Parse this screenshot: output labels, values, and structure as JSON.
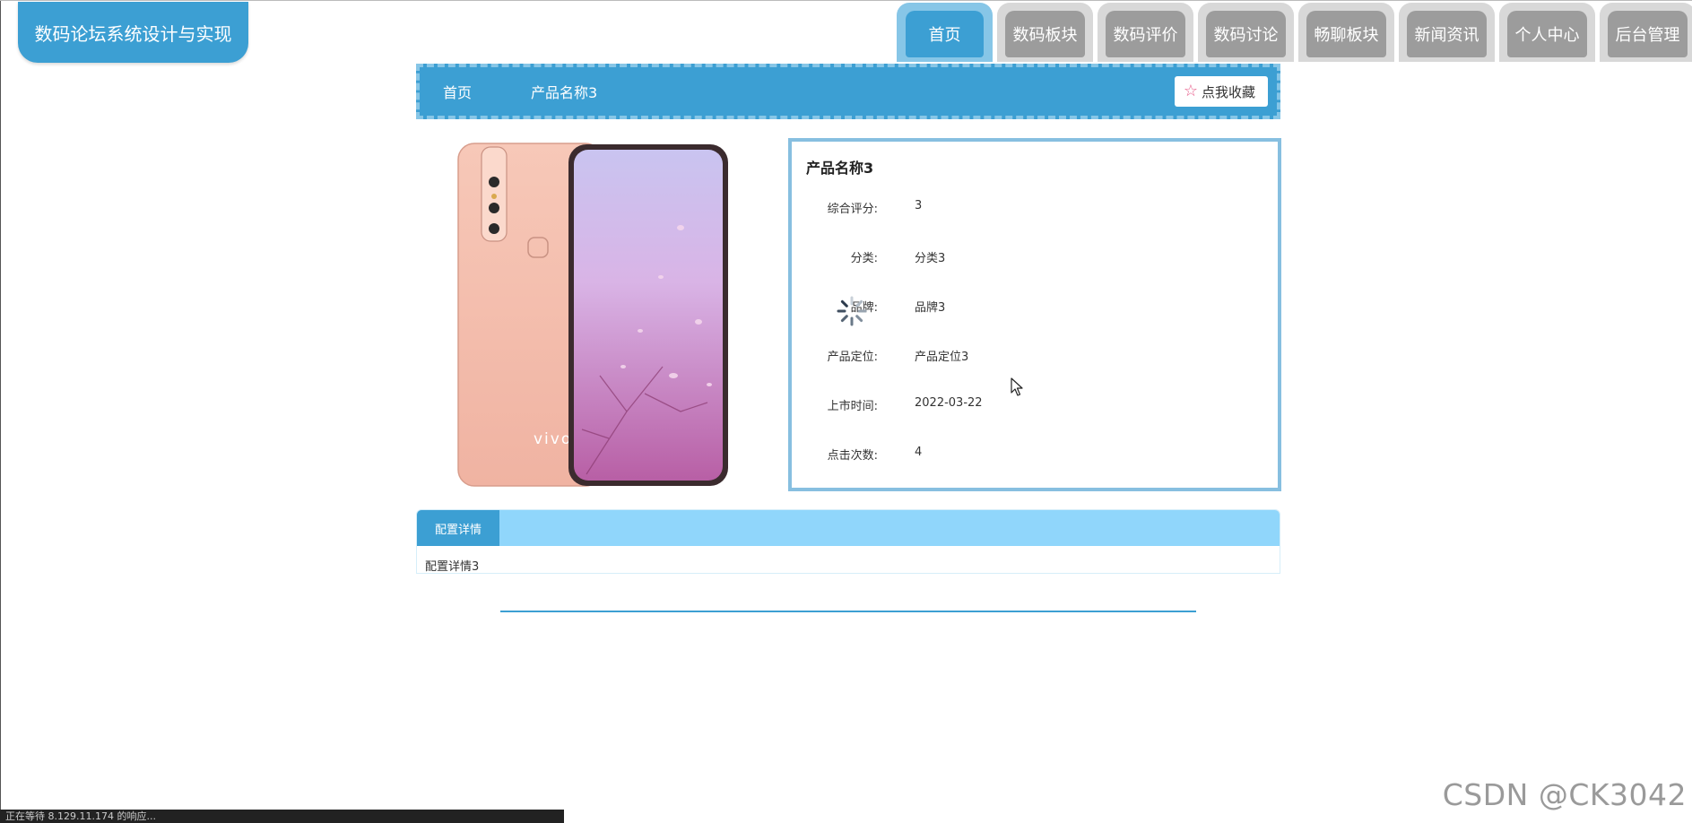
{
  "site": {
    "logo_text": "数码论坛系统设计与实现"
  },
  "nav": {
    "tabs": [
      {
        "label": "首页",
        "active": true
      },
      {
        "label": "数码板块",
        "active": false
      },
      {
        "label": "数码评价",
        "active": false
      },
      {
        "label": "数码讨论",
        "active": false
      },
      {
        "label": "畅聊板块",
        "active": false
      },
      {
        "label": "新闻资讯",
        "active": false
      },
      {
        "label": "个人中心",
        "active": false
      },
      {
        "label": "后台管理",
        "active": false
      }
    ]
  },
  "breadcrumb": {
    "home": "首页",
    "current": "产品名称3",
    "favorite_label": "点我收藏",
    "favorite_icon": "star-outline-icon"
  },
  "product": {
    "title": "产品名称3",
    "brand_logo_text": "vivo",
    "fields": [
      {
        "label": "综合评分:",
        "value": "3"
      },
      {
        "label": "分类:",
        "value": "分类3"
      },
      {
        "label": "品牌:",
        "value": "品牌3"
      },
      {
        "label": "产品定位:",
        "value": "产品定位3"
      },
      {
        "label": "上市时间:",
        "value": "2022-03-22"
      },
      {
        "label": "点击次数:",
        "value": "4"
      }
    ]
  },
  "details": {
    "tab_label": "配置详情",
    "content": "配置详情3"
  },
  "status_bar": {
    "text": "正在等待 8.129.11.174 的响应..."
  },
  "watermark": "CSDN @CK3042",
  "colors": {
    "primary": "#3c9fd3",
    "primary_light": "#87c6e7",
    "tab_header_bg": "#90d6fb",
    "inactive_tab": "#9c9c9c"
  }
}
